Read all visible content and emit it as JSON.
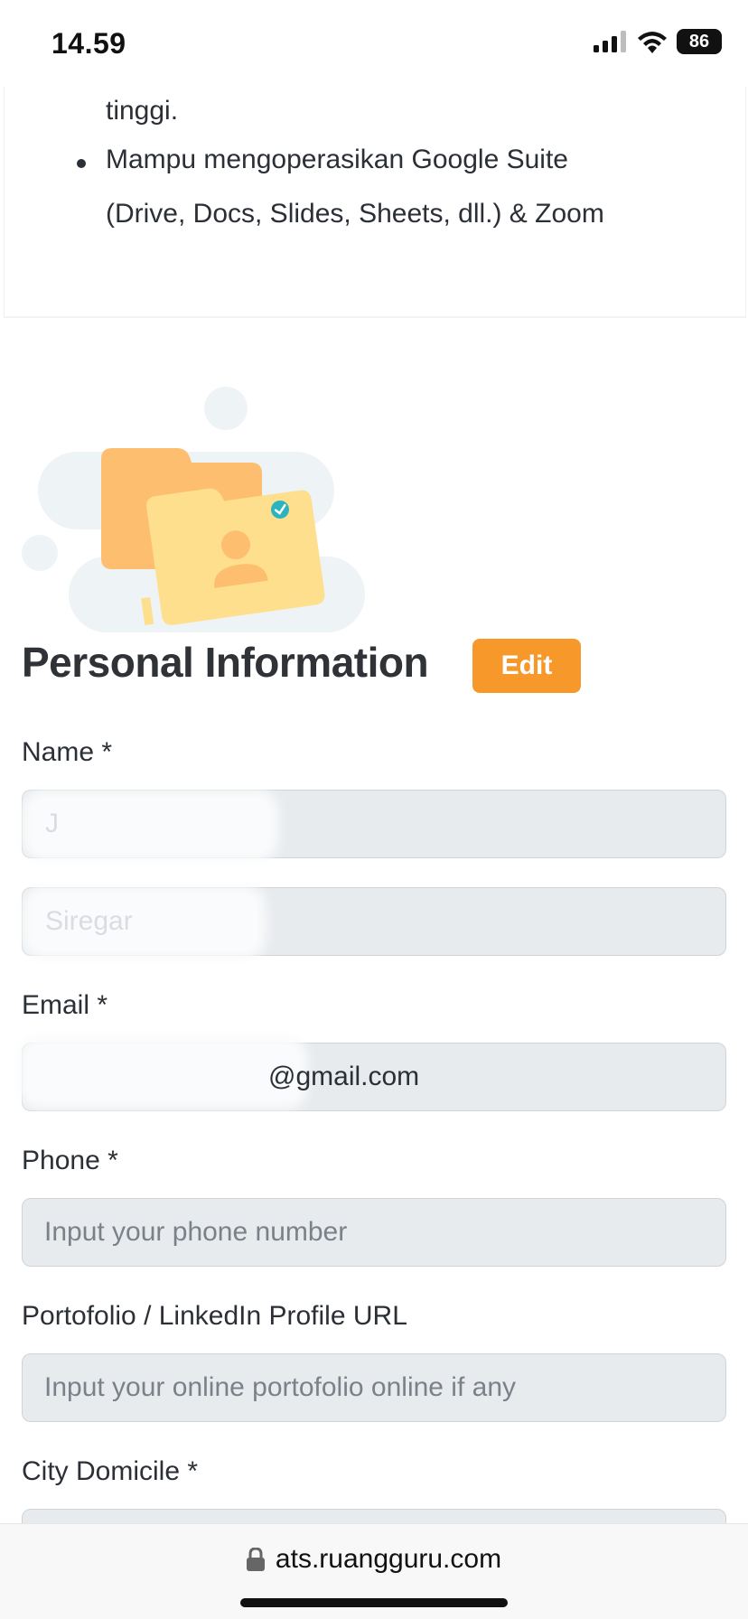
{
  "status_bar": {
    "time": "14.59",
    "battery": "86"
  },
  "description": {
    "line1": "tinggi.",
    "line2": "Mampu mengoperasikan Google Suite",
    "line3": "(Drive, Docs, Slides, Sheets, dll.) & Zoom"
  },
  "section": {
    "title": "Personal Information",
    "edit_label": "Edit"
  },
  "form": {
    "name_label": "Name *",
    "first_name_value": "J",
    "last_name_value": "Siregar",
    "email_label": "Email *",
    "email_value": "@gmail.com",
    "phone_label": "Phone *",
    "phone_placeholder": "Input your phone number",
    "portfolio_label": "Portofolio / LinkedIn Profile URL",
    "portfolio_placeholder": "Input your online portofolio online if any",
    "city_label": "City Domicile *"
  },
  "browser": {
    "url": "ats.ruangguru.com"
  },
  "colors": {
    "accent": "#f6992a",
    "field_bg": "#e8ebee",
    "check": "#2bb3c0"
  }
}
